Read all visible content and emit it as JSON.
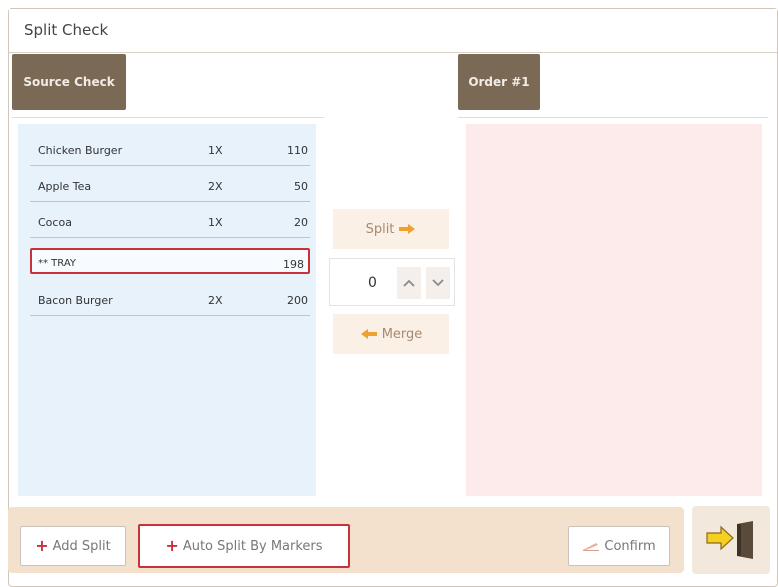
{
  "dialog": {
    "title": "Split Check"
  },
  "tabs": {
    "source": "Source Check",
    "order": "Order #1"
  },
  "source_items": [
    {
      "name": "Chicken Burger",
      "qty": "1X",
      "price": "110"
    },
    {
      "name": "Apple Tea",
      "qty": "2X",
      "price": "50"
    },
    {
      "name": "Cocoa",
      "qty": "1X",
      "price": "20"
    },
    {
      "name": "** TRAY",
      "qty": "",
      "price": "198"
    },
    {
      "name": "Bacon Burger",
      "qty": "2X",
      "price": "200"
    }
  ],
  "controls": {
    "split_label": "Split",
    "merge_label": "Merge",
    "quantity": "0"
  },
  "bottom": {
    "add_split": "Add Split",
    "auto_split": "Auto Split By Markers",
    "confirm": "Confirm"
  },
  "colors": {
    "accent": "#7a6a55",
    "highlight": "#c8323a",
    "arrow": "#f0a030",
    "source_bg": "#e8f2fb",
    "order_bg": "#fdeaea",
    "bottom_bar": "#f3e1cd"
  },
  "icons": {
    "split_arrow": "arrow-right-icon",
    "merge_arrow": "arrow-left-icon",
    "up": "chevron-up-icon",
    "down": "chevron-down-icon",
    "plus": "plus-icon",
    "confirm": "pencil-icon",
    "exit": "exit-door-icon"
  }
}
